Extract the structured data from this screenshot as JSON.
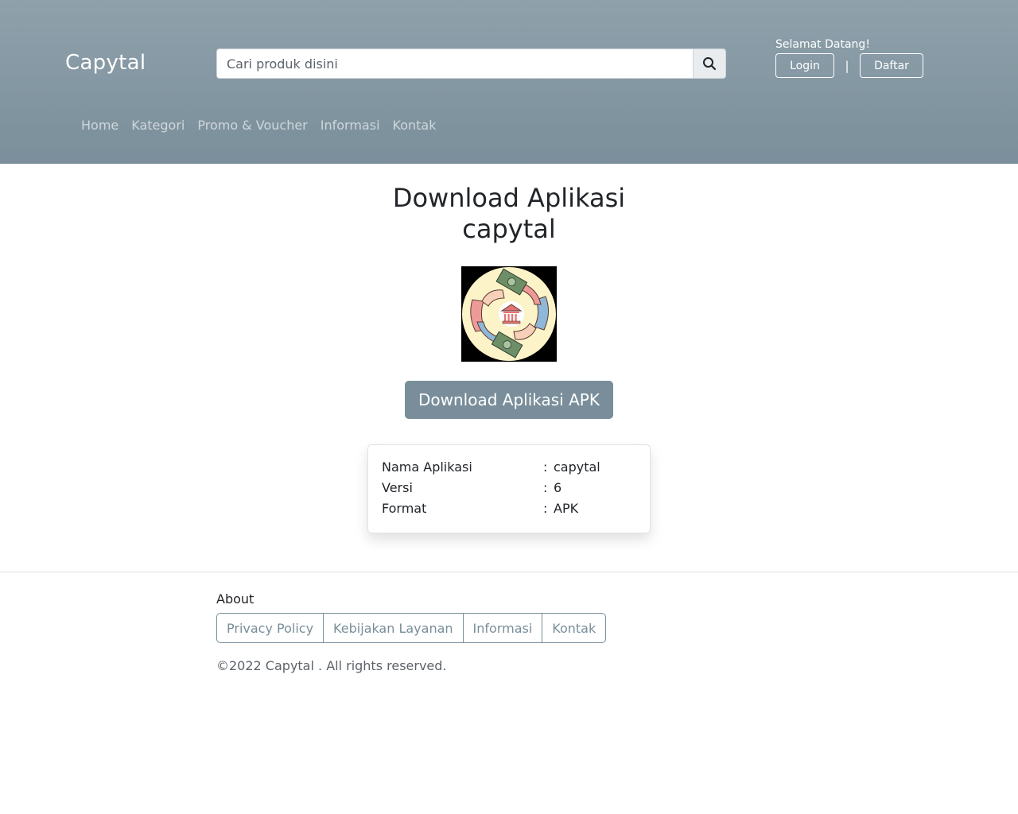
{
  "header": {
    "brand": "Capytal",
    "search": {
      "placeholder": "Cari produk disini",
      "value": ""
    },
    "welcome": "Selamat Datang!",
    "login_label": "Login",
    "separator": "|",
    "register_label": "Daftar",
    "nav": [
      "Home",
      "Kategori",
      "Promo & Voucher",
      "Informasi",
      "Kontak"
    ]
  },
  "main": {
    "title_line1": "Download Aplikasi",
    "title_line2": "capytal",
    "download_label": "Download Aplikasi APK",
    "info": [
      {
        "key": "Nama Aplikasi",
        "colon": ":",
        "value": "capytal"
      },
      {
        "key": "Versi",
        "colon": ":",
        "value": "6"
      },
      {
        "key": "Format",
        "colon": ":",
        "value": "APK"
      }
    ]
  },
  "footer": {
    "about": "About",
    "links": [
      "Privacy Policy",
      "Kebijakan Layanan",
      "Informasi",
      "Kontak"
    ],
    "copyright": "©2022 Capytal . All rights reserved."
  },
  "colors": {
    "header_top": "#8fa1ab",
    "header_bottom": "#7a8f9b",
    "accent": "#798e9a"
  },
  "icons": {
    "search": "search-icon",
    "app_logo": "bank-money-hands-icon"
  }
}
